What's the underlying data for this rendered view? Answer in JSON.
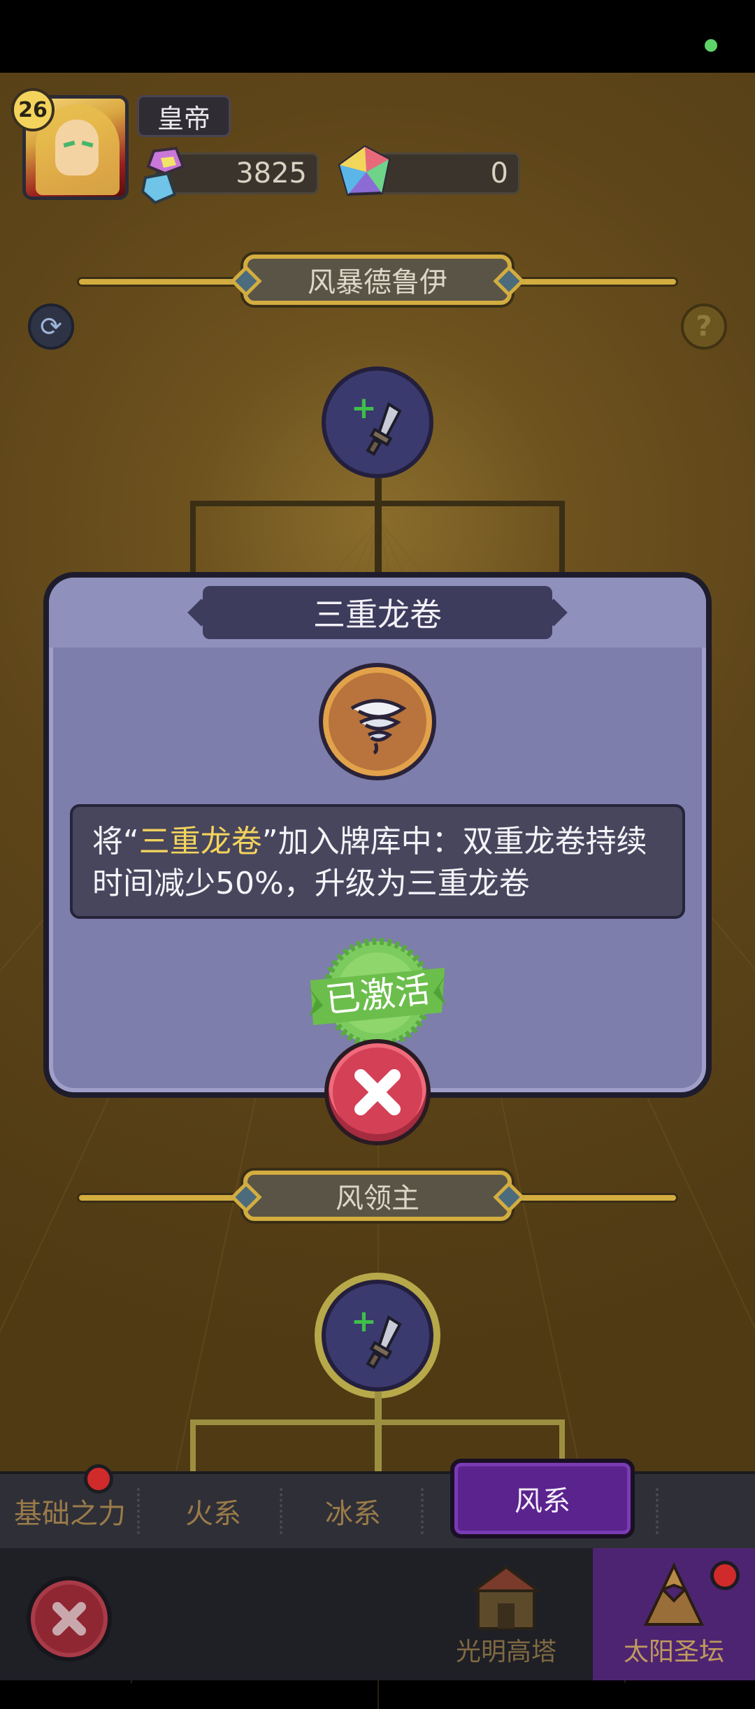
{
  "player": {
    "level": "26",
    "name": "皇帝"
  },
  "currencies": {
    "gems": "3825",
    "crystals": "0"
  },
  "sections": {
    "top": "风暴德鲁伊",
    "bottom": "风领主"
  },
  "dialog": {
    "title": "三重龙卷",
    "desc_prefix": "将“",
    "desc_highlight": "三重龙卷",
    "desc_suffix": "”加入牌库中：双重龙卷持续时间减少50%，升级为三重龙卷",
    "status_stamp": "已激活"
  },
  "tabs": [
    {
      "label": "基础之力"
    },
    {
      "label": "火系"
    },
    {
      "label": "冰系"
    },
    {
      "label": "风系"
    }
  ],
  "nav": {
    "tower": "光明高塔",
    "sun_altar": "太阳圣坛"
  },
  "icons": {
    "refresh": "refresh-icon",
    "help": "?"
  },
  "colors": {
    "accent_gold": "#d3ad3f",
    "dialog_bg": "#7d7eac",
    "highlight": "#f3d35c",
    "active_tab": "#5b238e",
    "close_red": "#d44056"
  }
}
